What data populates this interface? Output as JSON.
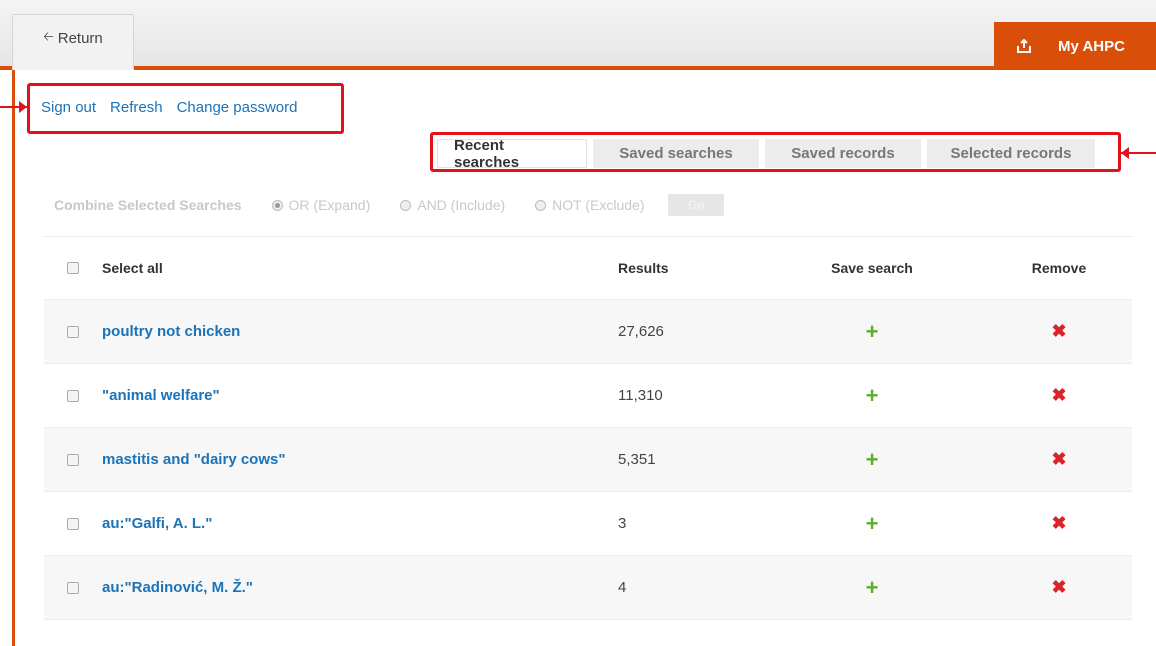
{
  "header": {
    "return_label": "Return",
    "my_ahpc_label": "My AHPC",
    "accent_color": "#d94f0a"
  },
  "account_links": [
    "Sign out",
    "Refresh",
    "Change password"
  ],
  "tabs": [
    {
      "label": "Recent searches",
      "active": true
    },
    {
      "label": "Saved searches",
      "active": false
    },
    {
      "label": "Saved records",
      "active": false
    },
    {
      "label": "Selected records",
      "active": false
    }
  ],
  "combine": {
    "label": "Combine Selected Searches",
    "options": [
      "OR (Expand)",
      "AND (Include)",
      "NOT (Exclude)"
    ],
    "go_label": "Go"
  },
  "table": {
    "headers": {
      "select_all": "Select all",
      "results": "Results",
      "save_search": "Save search",
      "remove": "Remove"
    },
    "rows": [
      {
        "query": "poultry not chicken",
        "results": "27,626"
      },
      {
        "query": "\"animal welfare\"",
        "results": "11,310"
      },
      {
        "query": "mastitis and \"dairy cows\"",
        "results": "5,351"
      },
      {
        "query": "au:\"Galfi, A. L.\"",
        "results": "3"
      },
      {
        "query": "au:\"Radinović, M. Ž.\"",
        "results": "4"
      }
    ],
    "save_icon": "plus-icon",
    "remove_icon": "x-icon"
  }
}
